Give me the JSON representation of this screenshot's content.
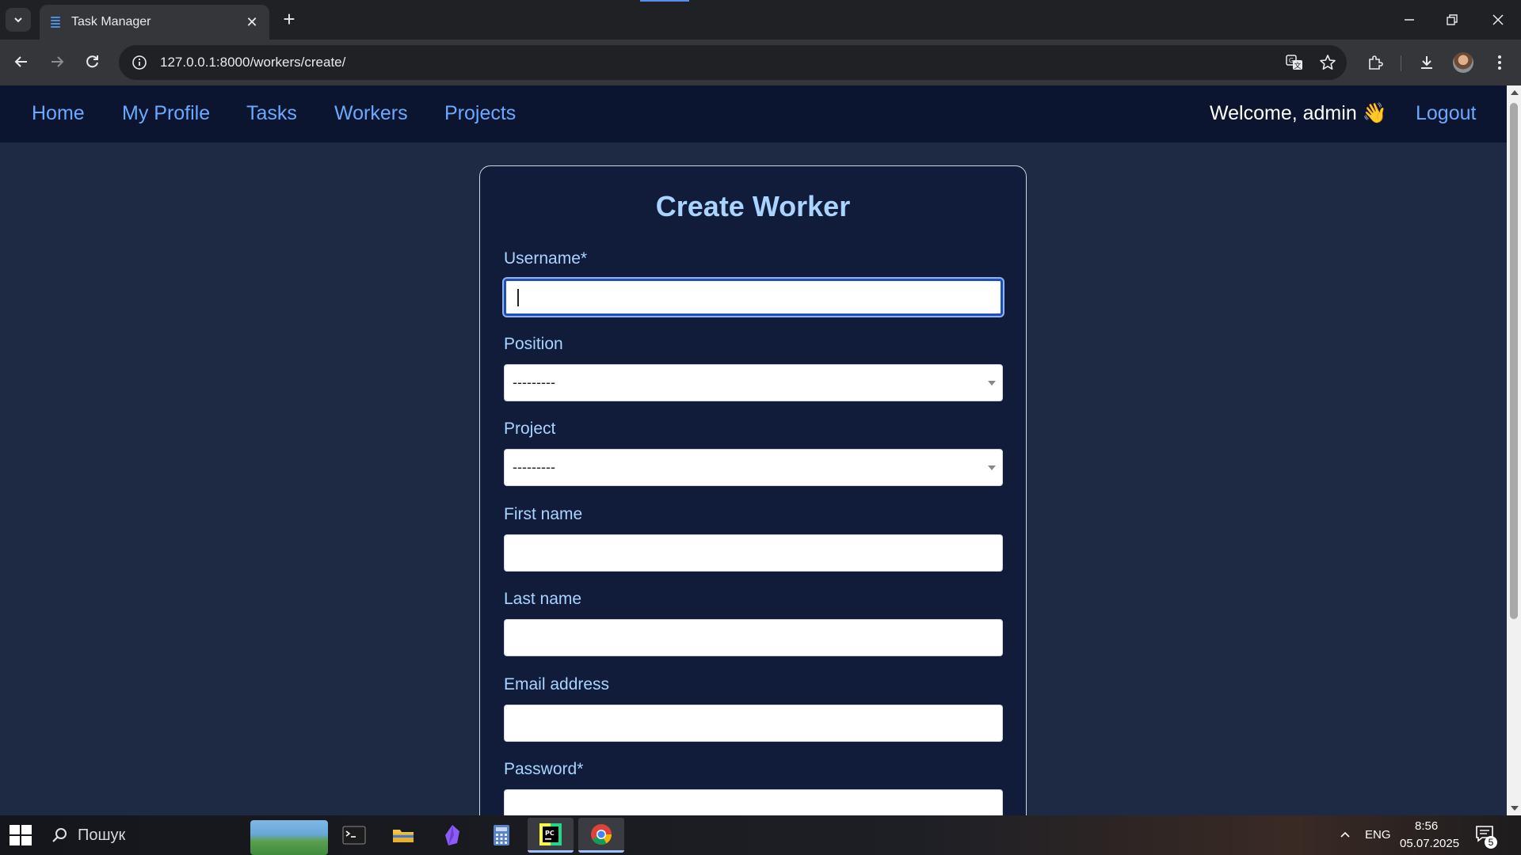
{
  "browser": {
    "tab_title": "Task Manager",
    "url": "127.0.0.1:8000/workers/create/"
  },
  "site_nav": {
    "links": [
      "Home",
      "My Profile",
      "Tasks",
      "Workers",
      "Projects"
    ],
    "welcome": "Welcome, admin 👋",
    "logout": "Logout"
  },
  "form": {
    "title": "Create Worker",
    "fields": [
      {
        "label": "Username*",
        "type": "text",
        "value": ""
      },
      {
        "label": "Position",
        "type": "select",
        "value": "---------"
      },
      {
        "label": "Project",
        "type": "select",
        "value": "---------"
      },
      {
        "label": "First name",
        "type": "text",
        "value": ""
      },
      {
        "label": "Last name",
        "type": "text",
        "value": ""
      },
      {
        "label": "Email address",
        "type": "text",
        "value": ""
      },
      {
        "label": "Password*",
        "type": "password",
        "value": ""
      }
    ]
  },
  "taskbar": {
    "search_placeholder": "Пошук",
    "language": "ENG",
    "time": "8:56",
    "date": "05.07.2025",
    "notification_count": "5"
  },
  "colors": {
    "page_bg": "#1e2a44",
    "nav_bg": "#0b1530",
    "card_bg": "#101c3a",
    "link": "#6aa9ff",
    "label": "#a9d4ff"
  }
}
